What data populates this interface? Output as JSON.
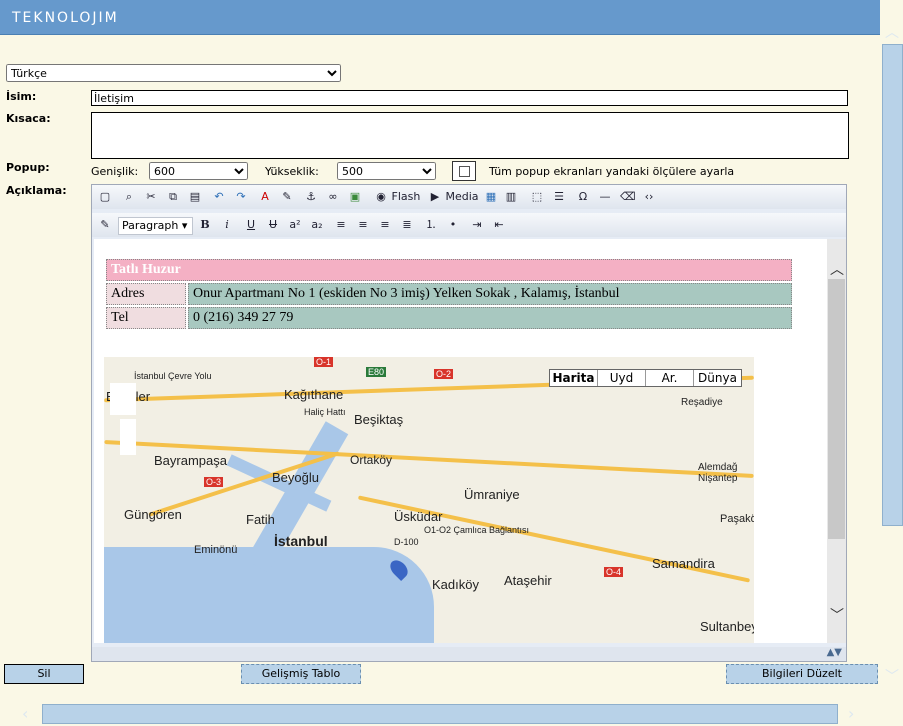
{
  "app": {
    "logo": "TEKNOLOJIM"
  },
  "language": {
    "selected": "Türkçe"
  },
  "labels": {
    "name": "İsim:",
    "short": "Kısaca:",
    "popup": "Popup:",
    "description": "Açıklama:"
  },
  "name_field": {
    "value": "İletişim"
  },
  "popup": {
    "width_label": "Genişlik:",
    "width_value": "600",
    "height_label": "Yükseklik:",
    "height_value": "500",
    "apply_all_label": "Tüm popup ekranları yandaki ölçülere ayarla"
  },
  "toolbar": {
    "flash": "Flash",
    "media": "Media",
    "paragraph": "Paragraph"
  },
  "contact": {
    "title": "Tatlı Huzur",
    "address_label": "Adres",
    "address": "Onur Apartmanı No 1 (eskiden No 3 imiş) Yelken Sokak , Kalamış, İstanbul",
    "tel_label": "Tel",
    "tel": "0 (216) 349 27 79"
  },
  "map": {
    "types": [
      "Harita",
      "Uyd",
      "Ar.",
      "Dünya"
    ],
    "places": [
      "Kağıthane",
      "Beşiktaş",
      "Reşadiye",
      "Bayrampaşa",
      "Beyoğlu",
      "Ortaköy",
      "Alemdağ Nişantep",
      "Ümraniye",
      "Güngören",
      "Fatih",
      "Üsküdar",
      "Paşakö",
      "Eminönü",
      "İstanbul",
      "Samandira",
      "Kadıköy",
      "Ataşehir",
      "Sultanbey",
      "Esenler"
    ],
    "road_labels": [
      "O-1",
      "O-2",
      "O-3",
      "O-4",
      "E80",
      "D-100",
      "İstanbul Çevre Yolu",
      "Haliç Hattı",
      "O1-O2 Çamlıca Bağlantısı"
    ]
  },
  "buttons": {
    "delete": "Sil",
    "advanced_table": "Gelişmiş Tablo",
    "update": "Bilgileri Düzelt"
  },
  "colors": {
    "header": "#6699cc",
    "background": "#faf8e6",
    "title_row": "#f4b0c4",
    "label_cell": "#f0dde0",
    "value_cell": "#a8c8c0",
    "button": "#b8d2e8"
  }
}
